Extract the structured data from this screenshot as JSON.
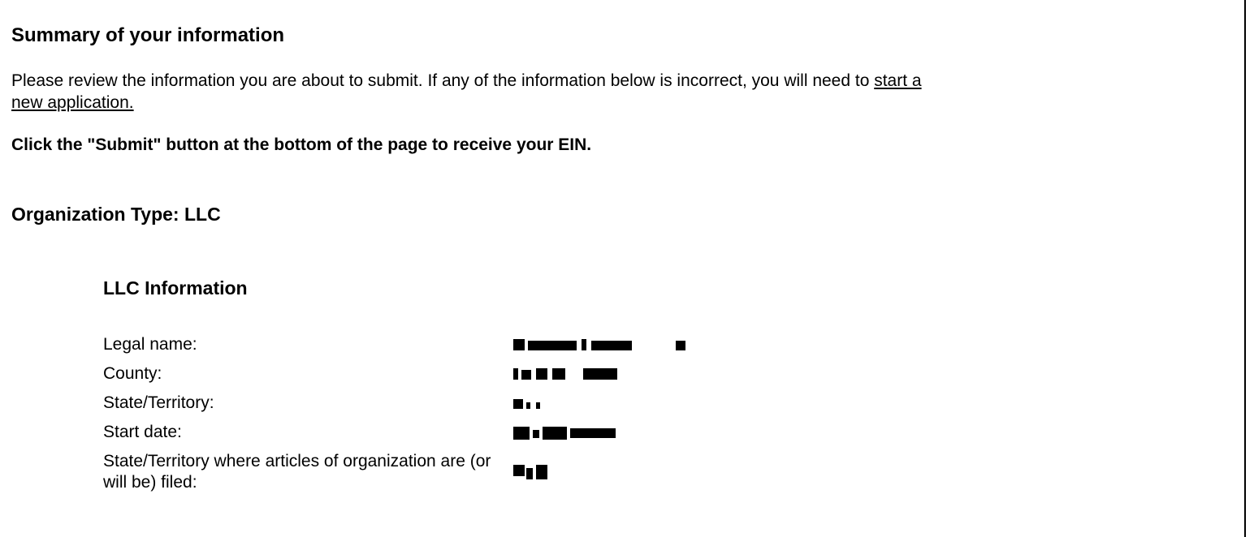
{
  "summary": {
    "title": "Summary of your information",
    "intro_text": "Please review the information you are about to submit. If any of the information below is incorrect, you will need to ",
    "intro_link": "start a new application.",
    "instruction": "Click the \"Submit\" button at the bottom of the page to receive your EIN."
  },
  "organization": {
    "type_label": "Organization Type: LLC"
  },
  "llc_info": {
    "heading": "LLC Information",
    "rows": [
      {
        "label": "Legal name:",
        "value": ""
      },
      {
        "label": "County:",
        "value": ""
      },
      {
        "label": "State/Territory:",
        "value": ""
      },
      {
        "label": "Start date:",
        "value": ""
      },
      {
        "label": "State/Territory where articles of organization are (or will be) filed:",
        "value": ""
      }
    ]
  }
}
